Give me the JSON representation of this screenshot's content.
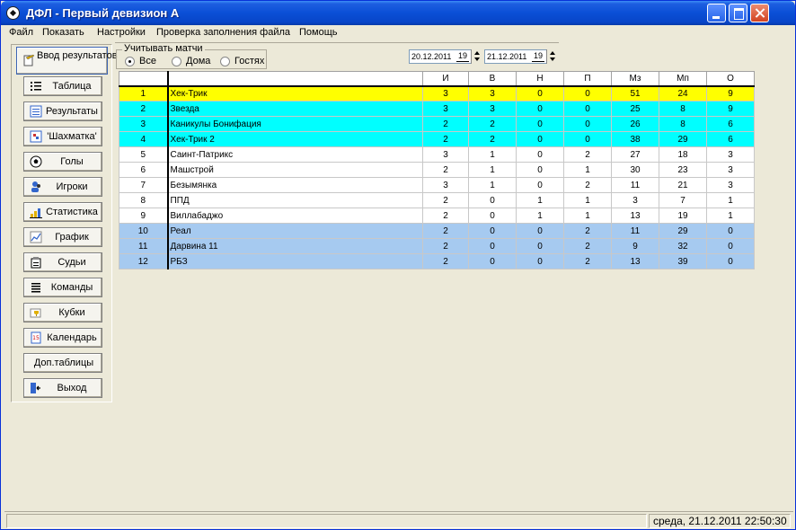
{
  "window": {
    "title": "ДФЛ - Первый девизион А"
  },
  "menu": [
    "Файл",
    "Показать",
    "Настройки",
    "Проверка заполнения файла",
    "Помощь"
  ],
  "sidebar": {
    "buttons": [
      {
        "label": "Ввод результатов",
        "icon": "pencil-icon"
      },
      {
        "label": "Таблица",
        "icon": "list-icon"
      },
      {
        "label": "Результаты",
        "icon": "results-icon"
      },
      {
        "label": "'Шахматка'",
        "icon": "chessboard-icon"
      },
      {
        "label": "Голы",
        "icon": "ball-icon"
      },
      {
        "label": "Игроки",
        "icon": "players-icon"
      },
      {
        "label": "Статистика",
        "icon": "statistics-icon"
      },
      {
        "label": "График",
        "icon": "chart-icon"
      },
      {
        "label": "Судьи",
        "icon": "referee-icon"
      },
      {
        "label": "Команды",
        "icon": "teams-icon"
      },
      {
        "label": "Кубки",
        "icon": "cup-icon"
      },
      {
        "label": "Календарь",
        "icon": "calendar-icon"
      },
      {
        "label": "Доп.таблицы",
        "icon": ""
      },
      {
        "label": "Выход",
        "icon": "exit-door-icon"
      }
    ]
  },
  "filter": {
    "group_label": "Учитывать матчи",
    "options": [
      {
        "label": "Все",
        "selected": true
      },
      {
        "label": "Дома",
        "selected": false
      },
      {
        "label": "Гостях",
        "selected": false
      }
    ]
  },
  "dates": {
    "from": {
      "text": "20.12.2011",
      "day": "19"
    },
    "to": {
      "text": "21.12.2011",
      "day": "19"
    }
  },
  "table": {
    "columns": [
      "",
      "",
      "И",
      "В",
      "Н",
      "П",
      "Мз",
      "Мп",
      "О"
    ],
    "rows": [
      {
        "pos": "1",
        "team": "Хек-Трик",
        "played": "3",
        "won": "3",
        "draw": "0",
        "lost": "0",
        "gf": "51",
        "ga": "24",
        "pts": "9",
        "color": "#ffff00"
      },
      {
        "pos": "2",
        "team": "Звезда",
        "played": "3",
        "won": "3",
        "draw": "0",
        "lost": "0",
        "gf": "25",
        "ga": "8",
        "pts": "9",
        "color": "#00ffff"
      },
      {
        "pos": "3",
        "team": "Каникулы Бонифация",
        "played": "2",
        "won": "2",
        "draw": "0",
        "lost": "0",
        "gf": "26",
        "ga": "8",
        "pts": "6",
        "color": "#00ffff"
      },
      {
        "pos": "4",
        "team": "Хек-Трик 2",
        "played": "2",
        "won": "2",
        "draw": "0",
        "lost": "0",
        "gf": "38",
        "ga": "29",
        "pts": "6",
        "color": "#00ffff"
      },
      {
        "pos": "5",
        "team": "Саинт-Патрикс",
        "played": "3",
        "won": "1",
        "draw": "0",
        "lost": "2",
        "gf": "27",
        "ga": "18",
        "pts": "3",
        "color": "#ffffff"
      },
      {
        "pos": "6",
        "team": "Машстрой",
        "played": "2",
        "won": "1",
        "draw": "0",
        "lost": "1",
        "gf": "30",
        "ga": "23",
        "pts": "3",
        "color": "#ffffff"
      },
      {
        "pos": "7",
        "team": "Безымянка",
        "played": "3",
        "won": "1",
        "draw": "0",
        "lost": "2",
        "gf": "11",
        "ga": "21",
        "pts": "3",
        "color": "#ffffff"
      },
      {
        "pos": "8",
        "team": "ППД",
        "played": "2",
        "won": "0",
        "draw": "1",
        "lost": "1",
        "gf": "3",
        "ga": "7",
        "pts": "1",
        "color": "#ffffff"
      },
      {
        "pos": "9",
        "team": "Виллабаджо",
        "played": "2",
        "won": "0",
        "draw": "1",
        "lost": "1",
        "gf": "13",
        "ga": "19",
        "pts": "1",
        "color": "#ffffff"
      },
      {
        "pos": "10",
        "team": "Реал",
        "played": "2",
        "won": "0",
        "draw": "0",
        "lost": "2",
        "gf": "11",
        "ga": "29",
        "pts": "0",
        "color": "#a6caf0"
      },
      {
        "pos": "11",
        "team": "Дарвина 11",
        "played": "2",
        "won": "0",
        "draw": "0",
        "lost": "2",
        "gf": "9",
        "ga": "32",
        "pts": "0",
        "color": "#a6caf0"
      },
      {
        "pos": "12",
        "team": "РБЗ",
        "played": "2",
        "won": "0",
        "draw": "0",
        "lost": "2",
        "gf": "13",
        "ga": "39",
        "pts": "0",
        "color": "#a6caf0"
      }
    ]
  },
  "status": {
    "left": "",
    "datetime": "среда, 21.12.2011 22:50:30"
  }
}
